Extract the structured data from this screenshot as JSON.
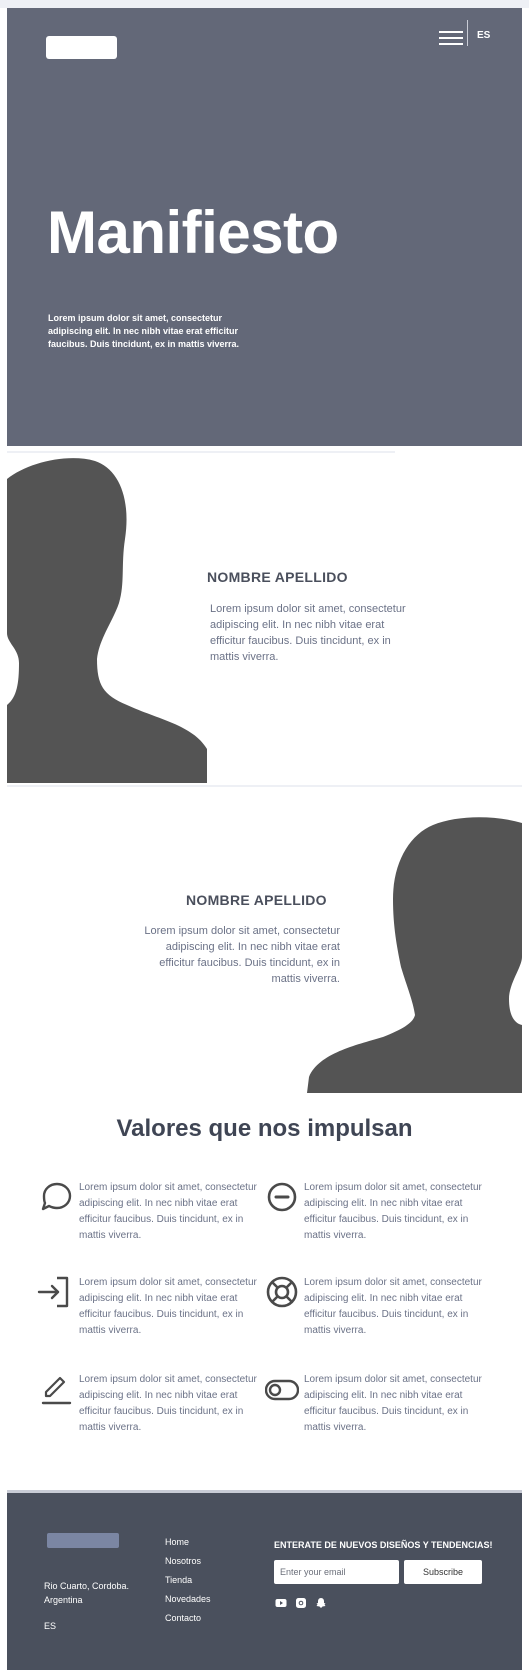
{
  "header": {
    "language": "ES"
  },
  "hero": {
    "title": "Manifiesto",
    "text": "Lorem ipsum dolor sit amet, consectetur adipiscing elit. In nec nibh vitae erat efficitur faucibus. Duis tincidunt, ex in mattis viverra."
  },
  "profiles": [
    {
      "name": "NOMBRE APELLIDO",
      "bio": "Lorem ipsum dolor sit amet, consectetur adipiscing elit. In nec nibh vitae erat efficitur faucibus. Duis tincidunt, ex in mattis viverra."
    },
    {
      "name": "NOMBRE APELLIDO",
      "bio": "Lorem ipsum dolor sit amet, consectetur adipiscing elit. In nec nibh vitae erat efficitur faucibus. Duis tincidunt, ex in mattis viverra."
    }
  ],
  "values": {
    "title": "Valores que nos impulsan",
    "items": [
      {
        "icon": "chat-bubble-icon",
        "text": "Lorem ipsum dolor sit amet, consectetur adipiscing elit. In nec nibh vitae erat efficitur faucibus. Duis tincidunt, ex in mattis viverra."
      },
      {
        "icon": "minus-circle-icon",
        "text": "Lorem ipsum dolor sit amet, consectetur adipiscing elit. In nec nibh vitae erat efficitur faucibus. Duis tincidunt, ex in mattis viverra."
      },
      {
        "icon": "log-in-icon",
        "text": "Lorem ipsum dolor sit amet, consectetur adipiscing elit. In nec nibh vitae erat efficitur faucibus. Duis tincidunt, ex in mattis viverra."
      },
      {
        "icon": "life-buoy-icon",
        "text": "Lorem ipsum dolor sit amet, consectetur adipiscing elit. In nec nibh vitae erat efficitur faucibus. Duis tincidunt, ex in mattis viverra."
      },
      {
        "icon": "pencil-icon",
        "text": "Lorem ipsum dolor sit amet, consectetur adipiscing elit. In nec nibh vitae erat efficitur faucibus. Duis tincidunt, ex in mattis viverra."
      },
      {
        "icon": "toggle-icon",
        "text": "Lorem ipsum dolor sit amet, consectetur adipiscing elit. In nec nibh vitae erat efficitur faucibus. Duis tincidunt, ex in mattis viverra."
      }
    ]
  },
  "footer": {
    "address_line1": "Rio Cuarto, Cordoba.",
    "address_line2": "Argentina",
    "language": "ES",
    "nav": [
      "Home",
      "Nosotros",
      "Tienda",
      "Novedades",
      "Contacto"
    ],
    "newsletter_title": "ENTERATE DE NUEVOS DISEÑOS Y TENDENCIAS!",
    "email_placeholder": "Enter your email",
    "subscribe_label": "Subscribe",
    "social": [
      "youtube-icon",
      "instagram-icon",
      "snapchat-icon"
    ]
  },
  "colors": {
    "hero_bg": "#636878",
    "footer_bg": "#4a505d",
    "silhouette": "#545454",
    "heading": "#3f4554",
    "body_text": "#6b7287"
  }
}
